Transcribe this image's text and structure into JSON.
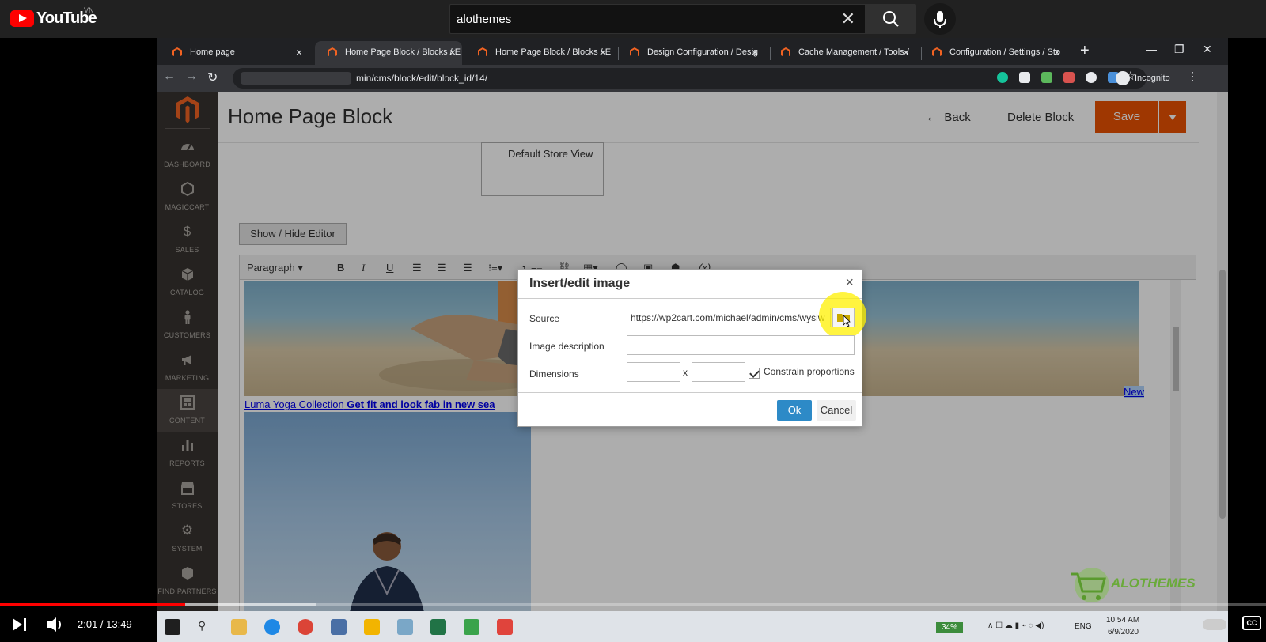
{
  "youtube": {
    "logo_text": "YouTube",
    "region": "VN",
    "search_query": "alothemes",
    "current_time": "2:01 / 13:49",
    "progress_fraction": 0.146,
    "cc_label": "CC"
  },
  "browser": {
    "tabs": [
      {
        "title": "Home page"
      },
      {
        "title": "Home Page Block / Blocks / E"
      },
      {
        "title": "Home Page Block / Blocks / E"
      },
      {
        "title": "Design Configuration / Desig"
      },
      {
        "title": "Cache Management / Tools /"
      },
      {
        "title": "Configuration / Settings / Sto"
      }
    ],
    "active_tab": 1,
    "url_visible": "min/cms/block/edit/block_id/14/",
    "profile_label": "Incognito"
  },
  "magento": {
    "sidebar": [
      {
        "label": "DASHBOARD",
        "icon": "dashboard-icon"
      },
      {
        "label": "MAGICCART",
        "icon": "hexagon-icon"
      },
      {
        "label": "SALES",
        "icon": "dollar-icon"
      },
      {
        "label": "CATALOG",
        "icon": "box-icon"
      },
      {
        "label": "CUSTOMERS",
        "icon": "person-icon"
      },
      {
        "label": "MARKETING",
        "icon": "megaphone-icon"
      },
      {
        "label": "CONTENT",
        "icon": "content-icon"
      },
      {
        "label": "REPORTS",
        "icon": "bar-chart-icon"
      },
      {
        "label": "STORES",
        "icon": "store-icon"
      },
      {
        "label": "SYSTEM",
        "icon": "gear-icon"
      },
      {
        "label": "FIND PARTNERS",
        "icon": "partners-icon"
      }
    ],
    "active_sidebar": 6,
    "page_title": "Home Page Block",
    "back_label": "Back",
    "delete_label": "Delete Block",
    "save_label": "Save",
    "store_view": "Default Store View",
    "show_hide_label": "Show / Hide Editor",
    "paragraph_format": "Paragraph",
    "editor_link_text": "Luma Yoga Collection",
    "editor_bold_text": "Get fit and look fab in new sea",
    "editor_new_link": "New"
  },
  "dialog": {
    "title": "Insert/edit image",
    "source_label": "Source",
    "source_value": "https://wp2cart.com/michael/admin/cms/wysiw",
    "description_label": "Image description",
    "description_value": "",
    "dimensions_label": "Dimensions",
    "width_value": "",
    "height_value": "",
    "x_label": "x",
    "constrain_label": "Constrain proportions",
    "constrain_checked": true,
    "ok_label": "Ok",
    "cancel_label": "Cancel"
  },
  "watermark": "ALOTHEMES",
  "taskbar": {
    "battery": "34%",
    "lang": "ENG",
    "time": "10:54 AM",
    "date": "6/9/2020"
  },
  "colors": {
    "magento_orange": "#eb5202",
    "sidebar_bg": "#373330",
    "youtube_red": "#ff0000",
    "ok_blue": "#2d8ac7"
  }
}
